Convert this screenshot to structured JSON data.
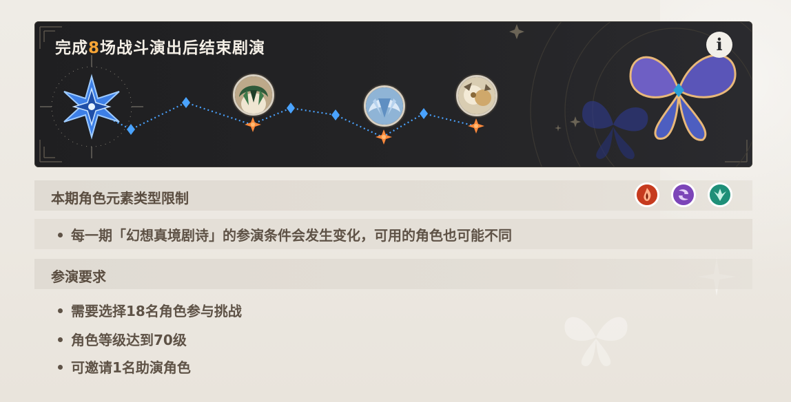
{
  "banner": {
    "title_prefix": "完成",
    "title_number": "8",
    "title_suffix": "场战斗演出后结束剧演",
    "info_icon": "info-icon",
    "progress_path": {
      "start_icon": "compass-star-icon",
      "avatars": [
        "character-avatar-green",
        "character-avatar-blue",
        "character-avatar-cream"
      ]
    }
  },
  "element_limit": {
    "title": "本期角色元素类型限制",
    "elements": [
      {
        "name": "pyro-icon",
        "color": "#e2562f"
      },
      {
        "name": "electro-icon",
        "color": "#9b63d4"
      },
      {
        "name": "anemo-icon",
        "color": "#2fb79a"
      }
    ],
    "note": "每一期「幻想真境剧诗」的参演条件会发生变化，可用的角色也可能不同"
  },
  "requirements": {
    "title": "参演要求",
    "items": [
      "需要选择18名角色参与挑战",
      "角色等级达到70级",
      "可邀请1名助演角色"
    ]
  },
  "colors": {
    "accent_orange": "#f6a536",
    "node_blue": "#4aa3ff",
    "node_orange": "#ff8a3c"
  }
}
